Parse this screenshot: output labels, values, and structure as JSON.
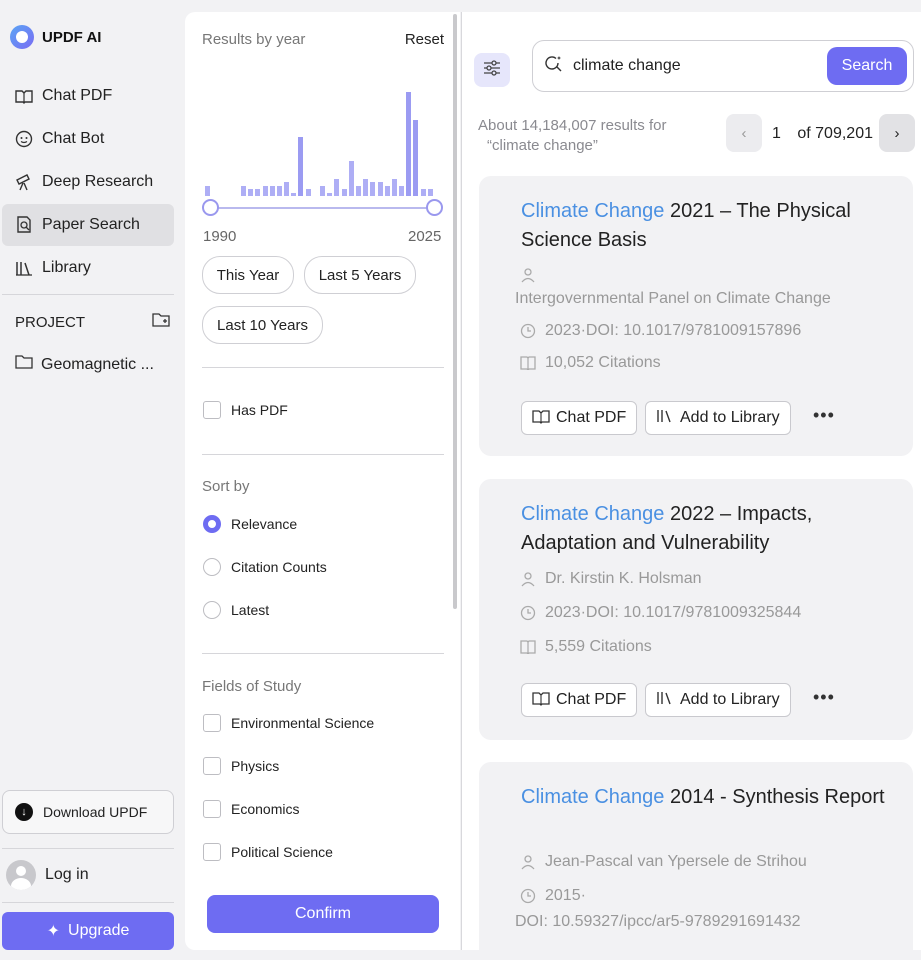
{
  "app": {
    "name": "UPDF AI"
  },
  "sidebar": {
    "items": [
      {
        "label": "Chat PDF",
        "icon": "book-sparkle-icon"
      },
      {
        "label": "Chat Bot",
        "icon": "bot-face-icon"
      },
      {
        "label": "Deep Research",
        "icon": "telescope-icon"
      },
      {
        "label": "Paper Search",
        "icon": "document-search-icon"
      },
      {
        "label": "Library",
        "icon": "library-icon"
      }
    ],
    "active_item": "Paper Search",
    "project_label": "PROJECT",
    "project_item": "Geomagnetic ...",
    "download_label": "Download UPDF",
    "login_label": "Log in",
    "upgrade_label": "Upgrade"
  },
  "filters": {
    "results_by_year": "Results by year",
    "reset": "Reset",
    "histogram_counts": [
      3,
      0,
      0,
      0,
      0,
      3,
      2,
      2,
      3,
      3,
      3,
      4,
      1,
      17,
      2,
      0,
      3,
      1,
      5,
      2,
      10,
      3,
      5,
      4,
      4,
      3,
      5,
      3,
      30,
      22,
      2,
      2
    ],
    "year_start": "1990",
    "year_end": "2025",
    "pills": [
      "This Year",
      "Last 5 Years",
      "Last 10 Years"
    ],
    "has_pdf": "Has PDF",
    "sort_by": "Sort by",
    "sort_options": [
      "Relevance",
      "Citation Counts",
      "Latest"
    ],
    "sort_selected": "Relevance",
    "fields_title": "Fields of Study",
    "fields": [
      "Environmental Science",
      "Physics",
      "Economics",
      "Political Science"
    ],
    "confirm": "Confirm"
  },
  "search": {
    "query": "climate change",
    "button": "Search",
    "results_count_line1": "About 14,184,007 results for",
    "results_count_line2": "“climate change”",
    "page_current": "1",
    "page_total": "of 709,201"
  },
  "results": [
    {
      "title_highlight": "Climate Change",
      "title_rest": " 2021 – The Physical Science Basis",
      "author": "",
      "org": "Intergovernmental Panel on Climate Change",
      "doi": "2023·DOI: 10.1017/9781009157896",
      "citations": "10,052 Citations",
      "chat_pdf": "Chat PDF",
      "add_library": "Add to Library"
    },
    {
      "title_highlight": "Climate Change",
      "title_rest": " 2022 – Impacts, Adaptation and Vulnerability",
      "author": "Dr. Kirstin K. Holsman",
      "doi": "2023·DOI: 10.1017/9781009325844",
      "citations": "5,559 Citations",
      "chat_pdf": "Chat PDF",
      "add_library": "Add to Library"
    },
    {
      "title_highlight": "Climate Change",
      "title_rest": " 2014 - Synthesis Report",
      "author": "Jean-Pascal van Ypersele de Strihou",
      "doi_year": "2015·",
      "doi": "DOI: 10.59327/ipcc/ar5-9789291691432"
    }
  ],
  "colors": {
    "accent": "#6e6cf2",
    "highlight": "#4a90e2"
  }
}
